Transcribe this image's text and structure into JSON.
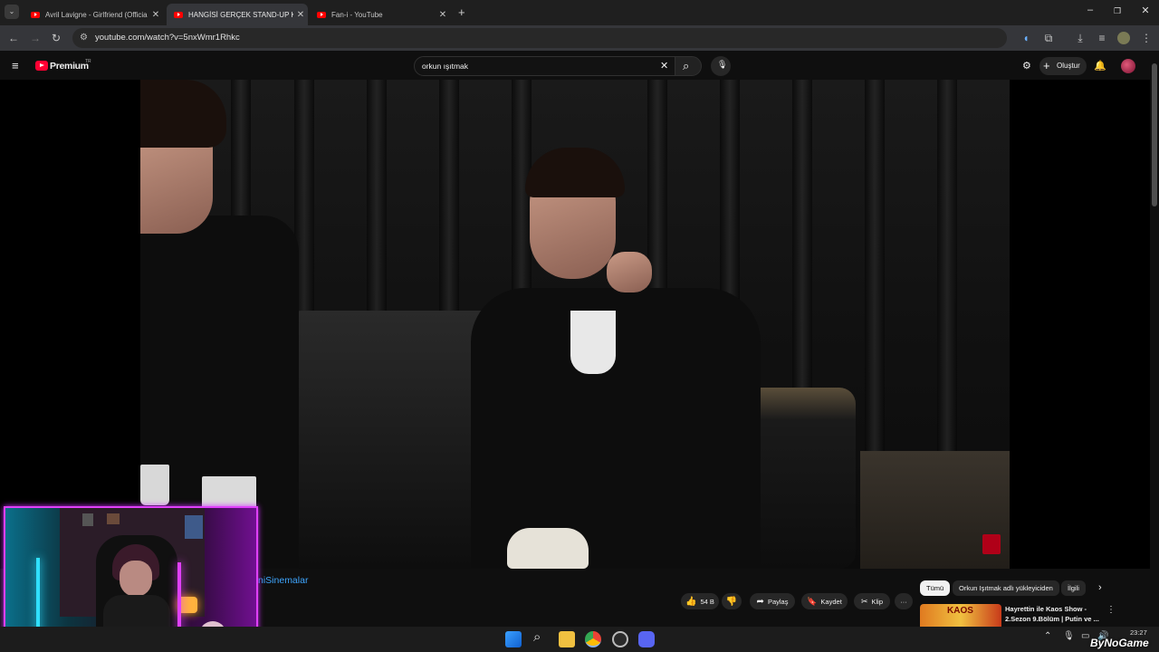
{
  "browser": {
    "tabs": [
      {
        "title": "Avril Lavigne - Girlfriend (Officia"
      },
      {
        "title": "HANGİSİ GERÇEK STAND-UP K"
      },
      {
        "title": "Fan-i - YouTube"
      }
    ],
    "new_tab": "+",
    "tab_close": "✕",
    "url": "youtube.com/watch?v=5nxWmr1Rhkc"
  },
  "youtube": {
    "logo_text": "Premium",
    "logo_region": "TR",
    "search_value": "orkun ışıtmak",
    "create_label": "Oluştur"
  },
  "video_meta": {
    "channel_name_partial": "niSinemalar",
    "like_count": "54 B",
    "share_label": "Paylaş",
    "save_label": "Kaydet",
    "clip_label": "Klip",
    "more": "···"
  },
  "watermark": {
    "brand": "ByNoGame"
  },
  "recommendations": {
    "chips": [
      "Tümü",
      "Orkun Işıtmak adlı yükleyiciden",
      "İlgili"
    ],
    "items": [
      {
        "title_line1": "Hayrettin ile Kaos Show -",
        "title_line2": "2.Sezon 9.Bölüm | Putin ve ...",
        "thumb_text": "KAOS"
      }
    ]
  },
  "taskbar": {
    "time": "23:27"
  },
  "colors": {
    "yt_red": "#ff0033",
    "webcam_border": "#e040fb",
    "channel_link": "#3ea6ff"
  }
}
